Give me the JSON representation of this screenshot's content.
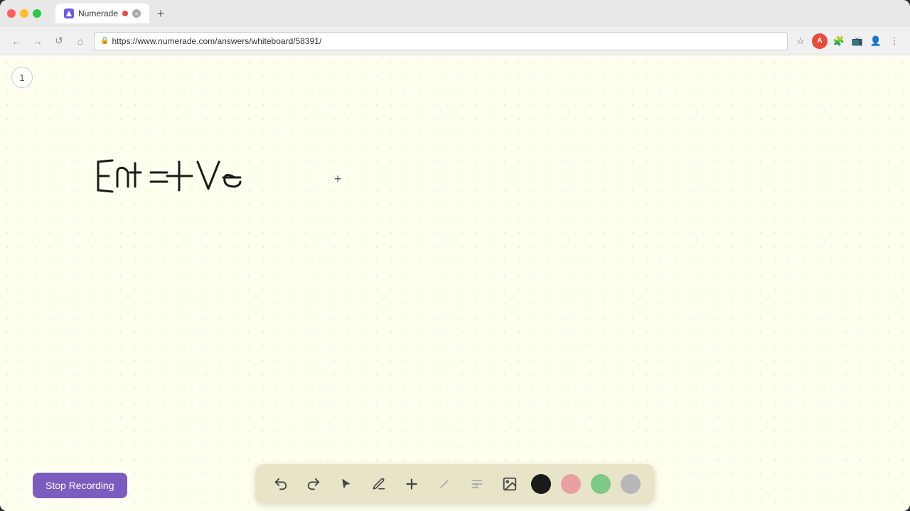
{
  "browser": {
    "tab_title": "Numerade",
    "tab_url": "https://www.numerade.com/answers/whiteboard/58391/",
    "new_tab_label": "+",
    "nav": {
      "back": "←",
      "forward": "→",
      "refresh": "↺",
      "home": "⌂"
    }
  },
  "page_indicator": "1",
  "equation": {
    "text": "E nt = +Ve"
  },
  "toolbar": {
    "undo_label": "↺",
    "redo_label": "↻",
    "select_label": "▶",
    "pen_label": "✏",
    "add_label": "+",
    "eraser_label": "/",
    "text_label": "A",
    "image_label": "🖼"
  },
  "colors": {
    "black": "#1a1a1a",
    "pink": "#e8a0a0",
    "green": "#7dc987",
    "gray": "#b8b8b8"
  },
  "stop_recording": {
    "label": "Stop Recording"
  }
}
